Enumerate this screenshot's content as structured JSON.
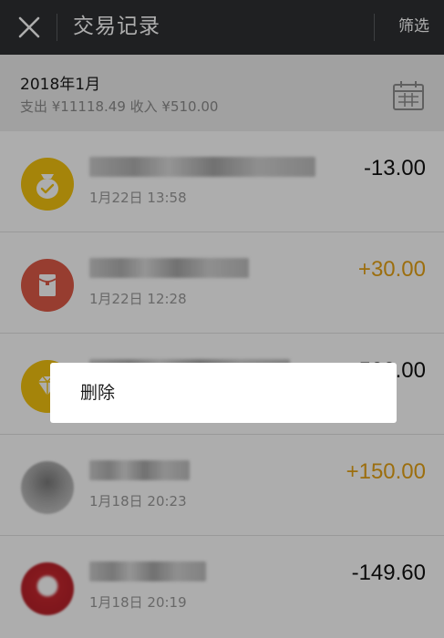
{
  "header": {
    "title": "交易记录",
    "filter_label": "筛选",
    "close_icon": "close-icon"
  },
  "month": {
    "label": "2018年1月",
    "summary": "支出 ¥11118.49 收入 ¥510.00",
    "calendar_icon": "calendar-icon"
  },
  "transactions": [
    {
      "icon": "money-bag-icon",
      "icon_color": "#f3c30f",
      "time": "1月22日 13:58",
      "amount": "-13.00",
      "type": "expense"
    },
    {
      "icon": "red-packet-icon",
      "icon_color": "#df5a47",
      "time": "1月22日 12:28",
      "amount": "+30.00",
      "type": "income"
    },
    {
      "icon": "diamond-icon",
      "icon_color": "#f3c30f",
      "time": "",
      "amount": "500.00",
      "type": "expense"
    },
    {
      "icon": "user-avatar",
      "icon_color": "#9a9a9a",
      "time": "1月18日 20:23",
      "amount": "+150.00",
      "type": "income"
    },
    {
      "icon": "user-avatar",
      "icon_color": "#c6262e",
      "time": "1月18日 20:19",
      "amount": "-149.60",
      "type": "expense"
    }
  ],
  "context_menu": {
    "delete_label": "删除"
  },
  "colors": {
    "titlebar": "#2e3033",
    "income": "#e6a316",
    "expense": "#111111",
    "overlay": "rgba(0,0,0,0.32)"
  }
}
